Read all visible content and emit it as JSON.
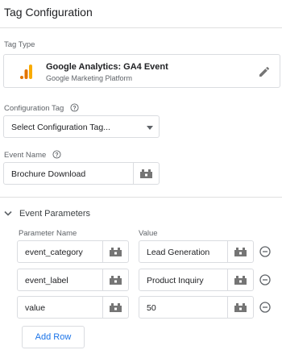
{
  "title": "Tag Configuration",
  "tag_type": {
    "label": "Tag Type",
    "name": "Google Analytics: GA4 Event",
    "platform": "Google Marketing Platform",
    "logo_icon": "google-analytics-icon",
    "edit_icon": "pencil-icon"
  },
  "configuration_tag": {
    "label": "Configuration Tag",
    "selected": "Select Configuration Tag..."
  },
  "event_name": {
    "label": "Event Name",
    "value": "Brochure Download"
  },
  "event_parameters": {
    "section_title": "Event Parameters",
    "col_name": "Parameter Name",
    "col_value": "Value",
    "rows": [
      {
        "name": "event_category",
        "value": "Lead Generation"
      },
      {
        "name": "event_label",
        "value": "Product Inquiry"
      },
      {
        "name": "value",
        "value": "50"
      }
    ],
    "add_row_label": "Add Row"
  },
  "colors": {
    "accent": "#1a73e8",
    "border": "#dadce0",
    "ga_orange": "#f9ab00",
    "ga_dark_orange": "#e37400"
  }
}
